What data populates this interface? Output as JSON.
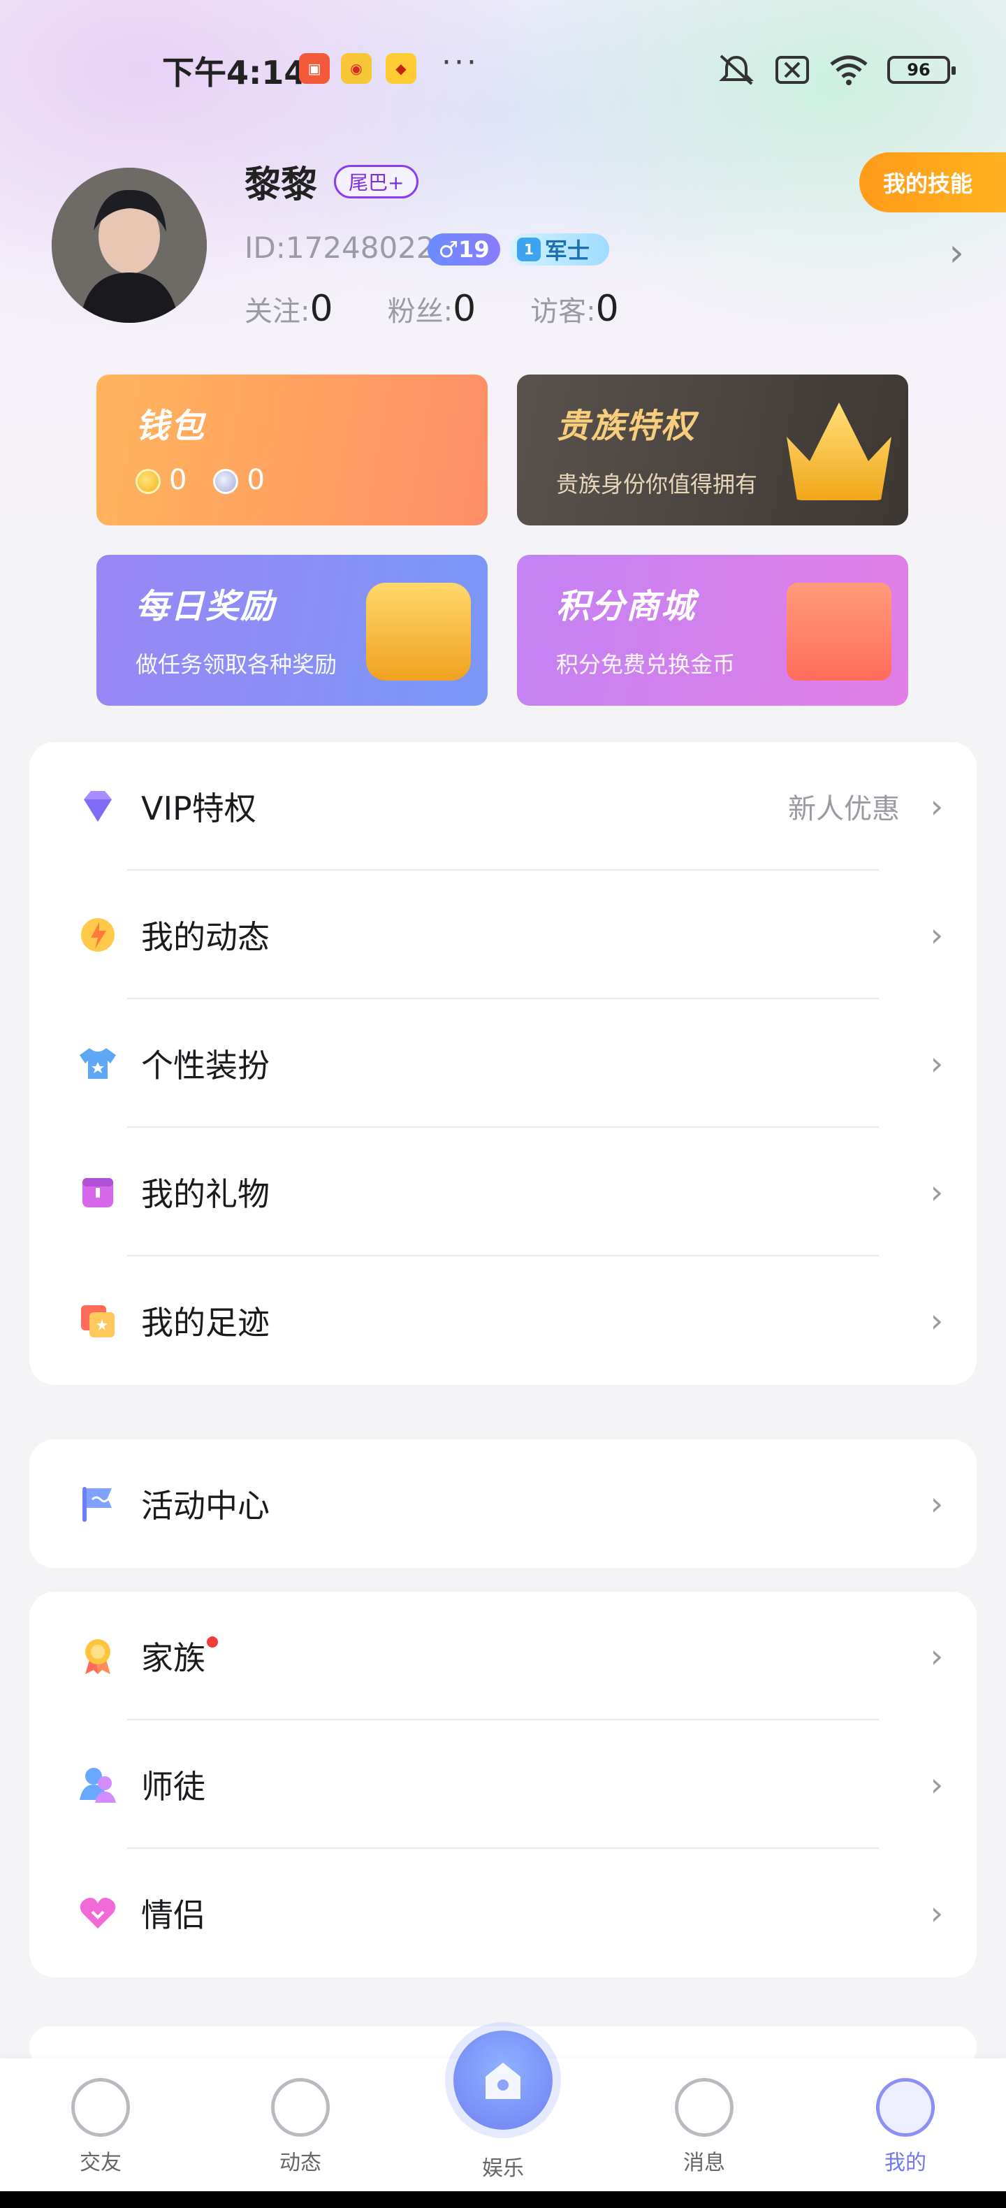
{
  "status_bar": {
    "time": "下午4:14",
    "app_icons": [
      "calendar-icon",
      "weibo-icon",
      "sogou-icon"
    ],
    "dots": "···",
    "battery": "96"
  },
  "profile": {
    "name": "黎黎",
    "tail_tag": "尾巴+",
    "skill_button": "我的技能",
    "id_text": "ID:17248022",
    "gender_badge": "♂19",
    "rank_num": "1",
    "rank_label": "军士",
    "stats": [
      {
        "label": "关注:",
        "value": "0"
      },
      {
        "label": "粉丝:",
        "value": "0"
      },
      {
        "label": "访客:",
        "value": "0"
      }
    ]
  },
  "cards": {
    "wallet": {
      "title": "钱包",
      "gold": "0",
      "silver": "0"
    },
    "noble": {
      "title": "贵族特权",
      "subtitle": "贵族身份你值得拥有"
    },
    "daily": {
      "title": "每日奖励",
      "subtitle": "做任务领取各种奖励"
    },
    "shop": {
      "title": "积分商城",
      "subtitle": "积分免费兑换金币"
    }
  },
  "menu1": [
    {
      "label": "VIP特权",
      "extra": "新人优惠",
      "icon": "diamond-icon"
    },
    {
      "label": "我的动态",
      "icon": "lightning-icon"
    },
    {
      "label": "个性装扮",
      "icon": "shirt-icon"
    },
    {
      "label": "我的礼物",
      "icon": "gift-box-icon"
    },
    {
      "label": "我的足迹",
      "icon": "footprint-card-icon"
    }
  ],
  "menu2": [
    {
      "label": "活动中心",
      "icon": "flag-icon"
    }
  ],
  "menu3": [
    {
      "label": "家族",
      "icon": "medal-icon"
    },
    {
      "label": "师徒",
      "icon": "mentor-icon"
    },
    {
      "label": "情侣",
      "icon": "heart-icon"
    }
  ],
  "chevron": "›",
  "tabbar": [
    {
      "label": "交友"
    },
    {
      "label": "动态"
    },
    {
      "label": "娱乐"
    },
    {
      "label": "消息"
    },
    {
      "label": "我的"
    }
  ],
  "colors": {
    "accent": "#7077f0",
    "skill_button": "#ff9b1a",
    "red_dot": "#f23c3c"
  }
}
